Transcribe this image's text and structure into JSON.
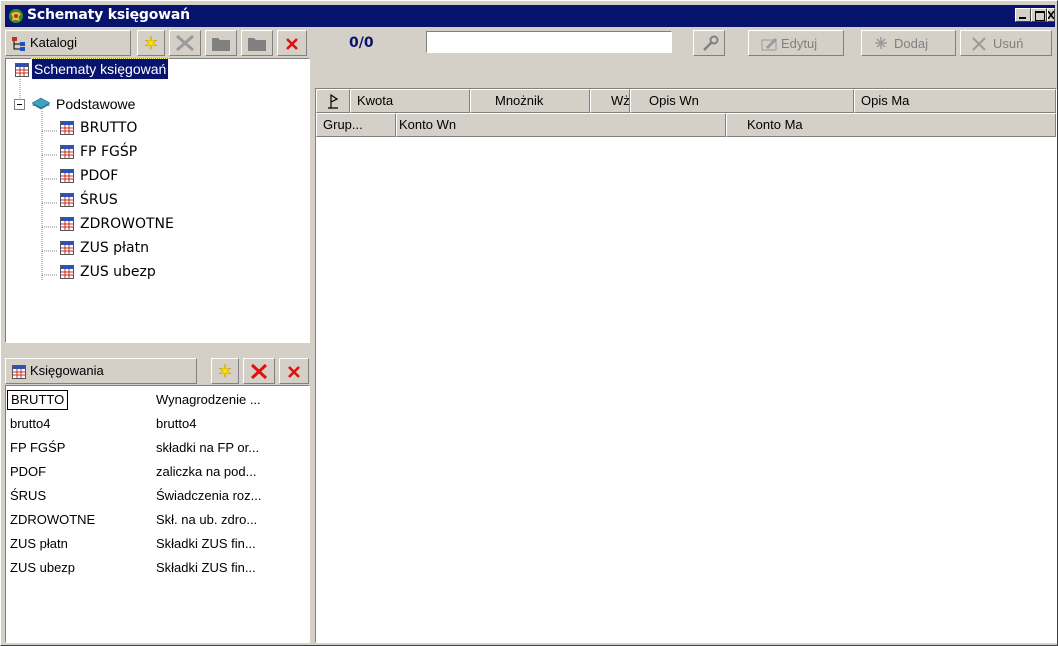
{
  "window": {
    "title": "Schematy księgowań"
  },
  "catalog_toolbar": {
    "label": "Katalogi"
  },
  "tree": {
    "root": "Schematy księgowań",
    "group": "Podstawowe",
    "items": [
      "BRUTTO",
      "FP FGŚP",
      "PDOF",
      "ŚRUS",
      "ZDROWOTNE",
      "ZUS płatn",
      "ZUS ubezp"
    ]
  },
  "postings_toolbar": {
    "label": "Księgowania"
  },
  "postings": [
    {
      "code": "BRUTTO",
      "desc": "Wynagrodzenie ..."
    },
    {
      "code": "brutto4",
      "desc": "brutto4"
    },
    {
      "code": "FP FGŚP",
      "desc": "składki na FP or..."
    },
    {
      "code": "PDOF",
      "desc": "zaliczka na pod..."
    },
    {
      "code": "ŚRUS",
      "desc": "Świadczenia roz..."
    },
    {
      "code": "ZDROWOTNE",
      "desc": "Skł. na ub. zdro..."
    },
    {
      "code": "ZUS płatn",
      "desc": "Składki ZUS fin..."
    },
    {
      "code": "ZUS ubezp",
      "desc": "Składki ZUS fin..."
    }
  ],
  "right_toolbar": {
    "counter": "0/0",
    "search_value": "",
    "edit_label": "Edytuj",
    "add_label": "Dodaj",
    "delete_label": "Usuń"
  },
  "grid_header_row1": [
    "Kwota",
    "Mnożnik",
    "Wż",
    "Opis Wn",
    "Opis Ma"
  ],
  "grid_header_row2": [
    "Grup...",
    "Konto Wn",
    "Konto Ma"
  ],
  "colors": {
    "titlebar": "#08136e",
    "selection": "#08136e",
    "face": "#d4d0c8"
  }
}
